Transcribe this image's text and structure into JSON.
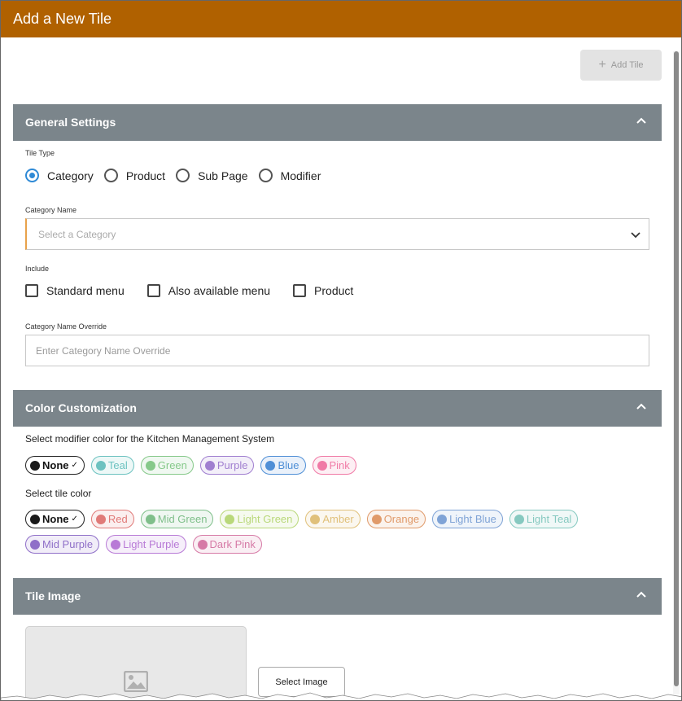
{
  "window": {
    "title": "Add a New Tile"
  },
  "toolbar": {
    "add_tile_label": "Add Tile"
  },
  "general": {
    "header": "General Settings",
    "tile_type_label": "Tile Type",
    "tile_types": [
      "Category",
      "Product",
      "Sub Page",
      "Modifier"
    ],
    "selected_tile_type": "Category",
    "category_name_label": "Category Name",
    "category_select_placeholder": "Select a Category",
    "include_label": "Include",
    "include_options": [
      "Standard menu",
      "Also available menu",
      "Product"
    ],
    "override_label": "Category Name Override",
    "override_placeholder": "Enter Category Name Override"
  },
  "color": {
    "header": "Color Customization",
    "kms_label": "Select modifier color for the Kitchen Management System",
    "kms_colors": [
      {
        "label": "None",
        "color": "#1a1a1a"
      },
      {
        "label": "Teal",
        "color": "#6cc2c0"
      },
      {
        "label": "Green",
        "color": "#86c98a"
      },
      {
        "label": "Purple",
        "color": "#a07fd0"
      },
      {
        "label": "Blue",
        "color": "#4f8fd6"
      },
      {
        "label": "Pink",
        "color": "#f07aa6"
      }
    ],
    "tile_label": "Select tile color",
    "tile_colors": [
      {
        "label": "None",
        "color": "#1a1a1a"
      },
      {
        "label": "Red",
        "color": "#e07a78"
      },
      {
        "label": "Mid Green",
        "color": "#7fbf8a"
      },
      {
        "label": "Light Green",
        "color": "#b9d87a"
      },
      {
        "label": "Amber",
        "color": "#e0c07a"
      },
      {
        "label": "Orange",
        "color": "#e09a6a"
      },
      {
        "label": "Light Blue",
        "color": "#7fa3d6"
      },
      {
        "label": "Light Teal",
        "color": "#86c9c0"
      },
      {
        "label": "Mid Purple",
        "color": "#8f6fc8"
      },
      {
        "label": "Light Purple",
        "color": "#b87ad6"
      },
      {
        "label": "Dark Pink",
        "color": "#d67aa6"
      }
    ]
  },
  "image": {
    "header": "Tile Image",
    "select_label": "Select Image"
  }
}
